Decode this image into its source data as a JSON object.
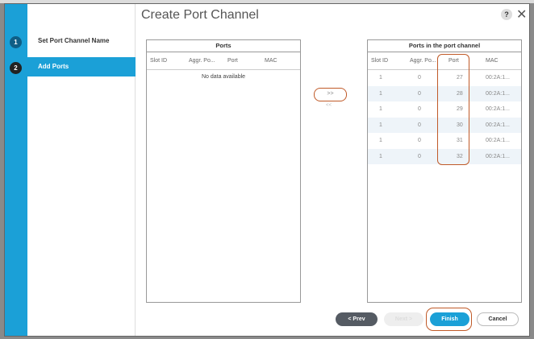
{
  "dialog": {
    "title": "Create Port Channel",
    "help": "?",
    "close": "✕"
  },
  "steps": [
    {
      "num": "1",
      "label": "Set Port Channel Name"
    },
    {
      "num": "2",
      "label": "Add Ports"
    }
  ],
  "left_table": {
    "title": "Ports",
    "columns": [
      "Slot ID",
      "Aggr. Po...",
      "Port",
      "MAC"
    ],
    "empty": "No data available"
  },
  "right_table": {
    "title": "Ports in the port channel",
    "columns": [
      "Slot ID",
      "Aggr. Po...",
      "Port",
      "MAC"
    ],
    "rows": [
      [
        "1",
        "0",
        "27",
        "00:2A:1..."
      ],
      [
        "1",
        "0",
        "28",
        "00:2A:1..."
      ],
      [
        "1",
        "0",
        "29",
        "00:2A:1..."
      ],
      [
        "1",
        "0",
        "30",
        "00:2A:1..."
      ],
      [
        "1",
        "0",
        "31",
        "00:2A:1..."
      ],
      [
        "1",
        "0",
        "32",
        "00:2A:1..."
      ]
    ]
  },
  "move": {
    "add": ">>",
    "remove": "<<"
  },
  "buttons": {
    "prev": "< Prev",
    "next": "Next >",
    "finish": "Finish",
    "cancel": "Cancel"
  }
}
